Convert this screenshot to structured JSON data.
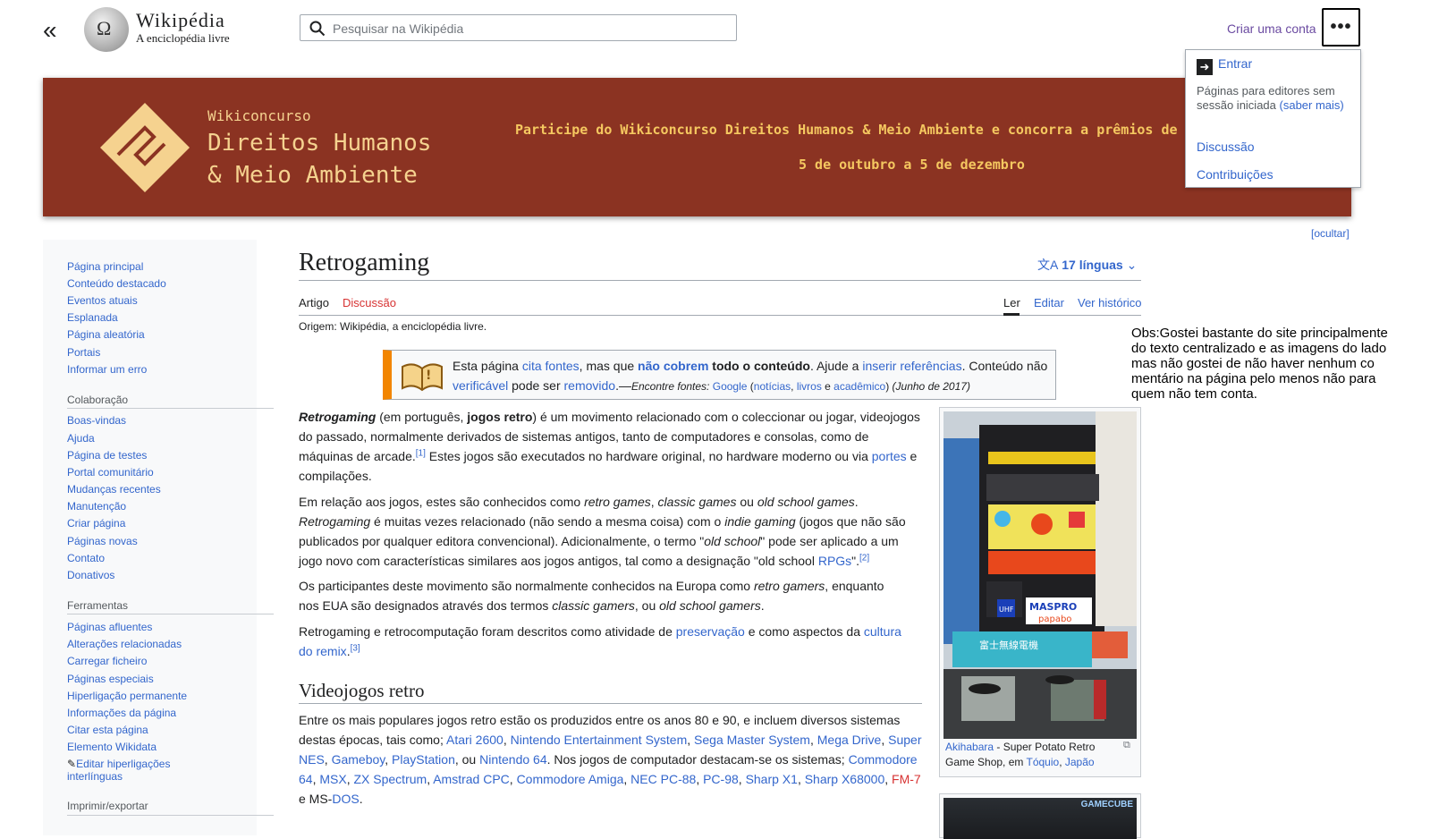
{
  "header": {
    "collapse_glyph": "«",
    "wordmark": "Wikipédia",
    "tagline": "A enciclopédia livre",
    "search_placeholder": "Pesquisar na Wikipédia",
    "create_account": "Criar uma conta",
    "more_glyph": "•••"
  },
  "dropdown": {
    "login": "Entrar",
    "note": "Páginas para editores sem sessão iniciada",
    "learn_more": "(saber mais)",
    "discussion": "Discussão",
    "contributions": "Contribuições"
  },
  "banner": {
    "subtitle": "Wikiconcurso",
    "title_line1": "Direitos Humanos",
    "title_line2": "& Meio Ambiente",
    "promo": "Participe do Wikiconcurso Direitos Humanos & Meio Ambiente e concorra a prêmios de",
    "dates": "5 de outubro a 5 de dezembro",
    "hide": "[ocultar]",
    "colors": {
      "background": "#8b3322",
      "accent": "#f5c860"
    }
  },
  "sidebar": {
    "main_links": [
      "Página principal",
      "Conteúdo destacado",
      "Eventos atuais",
      "Esplanada",
      "Página aleatória",
      "Portais",
      "Informar um erro"
    ],
    "collab_title": "Colaboração",
    "collab_links": [
      "Boas-vindas",
      "Ajuda",
      "Página de testes",
      "Portal comunitário",
      "Mudanças recentes",
      "Manutenção",
      "Criar página",
      "Páginas novas",
      "Contato",
      "Donativos"
    ],
    "tools_title": "Ferramentas",
    "tools_links": [
      "Páginas afluentes",
      "Alterações relacionadas",
      "Carregar ficheiro",
      "Páginas especiais",
      "Hiperligação permanente",
      "Informações da página",
      "Citar esta página",
      "Elemento Wikidata"
    ],
    "edit_links_l1": "Editar hiperligações",
    "edit_links_l2": "interlínguas",
    "print_title": "Imprimir/exportar"
  },
  "article": {
    "title": "Retrogaming",
    "languages": "17 línguas",
    "tabs": {
      "article": "Artigo",
      "talk": "Discussão",
      "read": "Ler",
      "edit": "Editar",
      "history": "Ver histórico"
    },
    "origin": "Origem: Wikipédia, a enciclopédia livre.",
    "ambox": {
      "t1": "Esta página ",
      "cite": "cita fontes",
      "t2": ", mas que ",
      "not_cover": "não cobrem",
      "t3": " todo o conteúdo",
      "t4": ". Ajude a ",
      "insert_refs": "inserir referências",
      "t5": ". Conteúdo não",
      "verifiable": "verificável",
      "t6": " pode ser ",
      "removed": "removido",
      "t7": ".—",
      "find": "Encontre fontes: ",
      "google": "Google",
      "news_open": " (",
      "news": "notícias",
      "comma": ", ",
      "books": "livros",
      "and": " e ",
      "academic": "acadêmico",
      "close": ")",
      "date": " (Junho de 2017)"
    },
    "p1": {
      "b1": "Retrogaming",
      "t1": " (em português, ",
      "b2": "jogos retro",
      "t2": ") é um movimento relacionado com o coleccionar ou jogar, videojogos do passado, normalmente derivados de sistemas antigos, tanto de computadores e consolas, como de máquinas de arcade.",
      "ref1": "[1]",
      "t3": " Estes jogos são executados no hardware original, no hardware moderno ou via ",
      "ports": "portes",
      "t4": " e compilações."
    },
    "p2": {
      "t1": "Em relação aos jogos, estes são conhecidos como ",
      "i1": "retro games",
      "c1": ", ",
      "i2": "classic games",
      "t2": " ou ",
      "i3": "old school games",
      "t3": ". ",
      "i4": "Retrogaming",
      "t4": " é muitas vezes relacionado (não sendo a mesma coisa) com o ",
      "i5": "indie gaming",
      "t5": " (jogos que não são publicados por qualquer editora convencional). Adicionalmente, o termo \"",
      "i6": "old school",
      "t6": "\" pode ser aplicado a um jogo novo com características similares aos jogos antigos, tal como a designação \"old school ",
      "rpgs": "RPGs",
      "t7": "\".",
      "ref2": "[2]"
    },
    "p3": {
      "t1": "Os participantes deste movimento são normalmente conhecidos na Europa como ",
      "i1": "retro gamers",
      "t2": ", enquanto nos EUA são designados através dos termos ",
      "i2": "classic gamers",
      "t3": ", ou ",
      "i3": "old school gamers",
      "t4": "."
    },
    "p4": {
      "t1": "Retrogaming e retrocomputação foram descritos como atividade de ",
      "preservation": "preservação",
      "t2": " e como aspectos da ",
      "remix": "cultura do remix",
      "t3": ".",
      "ref3": "[3]"
    },
    "h2": "Videojogos retro",
    "p5": {
      "t1": "Entre os mais populares jogos retro estão os produzidos entre os anos 80 e 90, e incluem diversos sistemas destas épocas, tais como; ",
      "consoles": [
        "Atari 2600",
        "Nintendo Entertainment System",
        "Sega Master System",
        "Mega Drive",
        "Super NES",
        "Gameboy",
        "PlayStation"
      ],
      "t2": ", ou ",
      "n64": "Nintendo 64",
      "t3": ". Nos jogos de computador destacam-se os sistemas; ",
      "computers": [
        "Commodore 64",
        "MSX",
        "ZX Spectrum",
        "Amstrad CPC",
        "Commodore Amiga",
        "NEC PC-88",
        "PC-98",
        "Sharp X1",
        "Sharp X68000"
      ],
      "fm7": "FM-7",
      "t4": " e MS-",
      "dos": "DOS",
      "t5": "."
    },
    "caption": {
      "akihabara": "Akihabara",
      "t1": " - Super Potato Retro",
      "t2": "Game Shop, em ",
      "tokyo": "Tóquio",
      "comma": ", ",
      "japan": "Japão"
    },
    "store_signs": {
      "maspro": "MASPRO",
      "papabo": "papabo",
      "fuji": "富士無線電機",
      "uhf": "UHF",
      "gamecube": "GAMECUBE"
    }
  },
  "obs": "Obs:Gostei bastante do site principalmente do texto centralizado e as imagens do lado mas não gostei de não haver nenhum co mentário na página pelo menos não para quem não tem conta."
}
